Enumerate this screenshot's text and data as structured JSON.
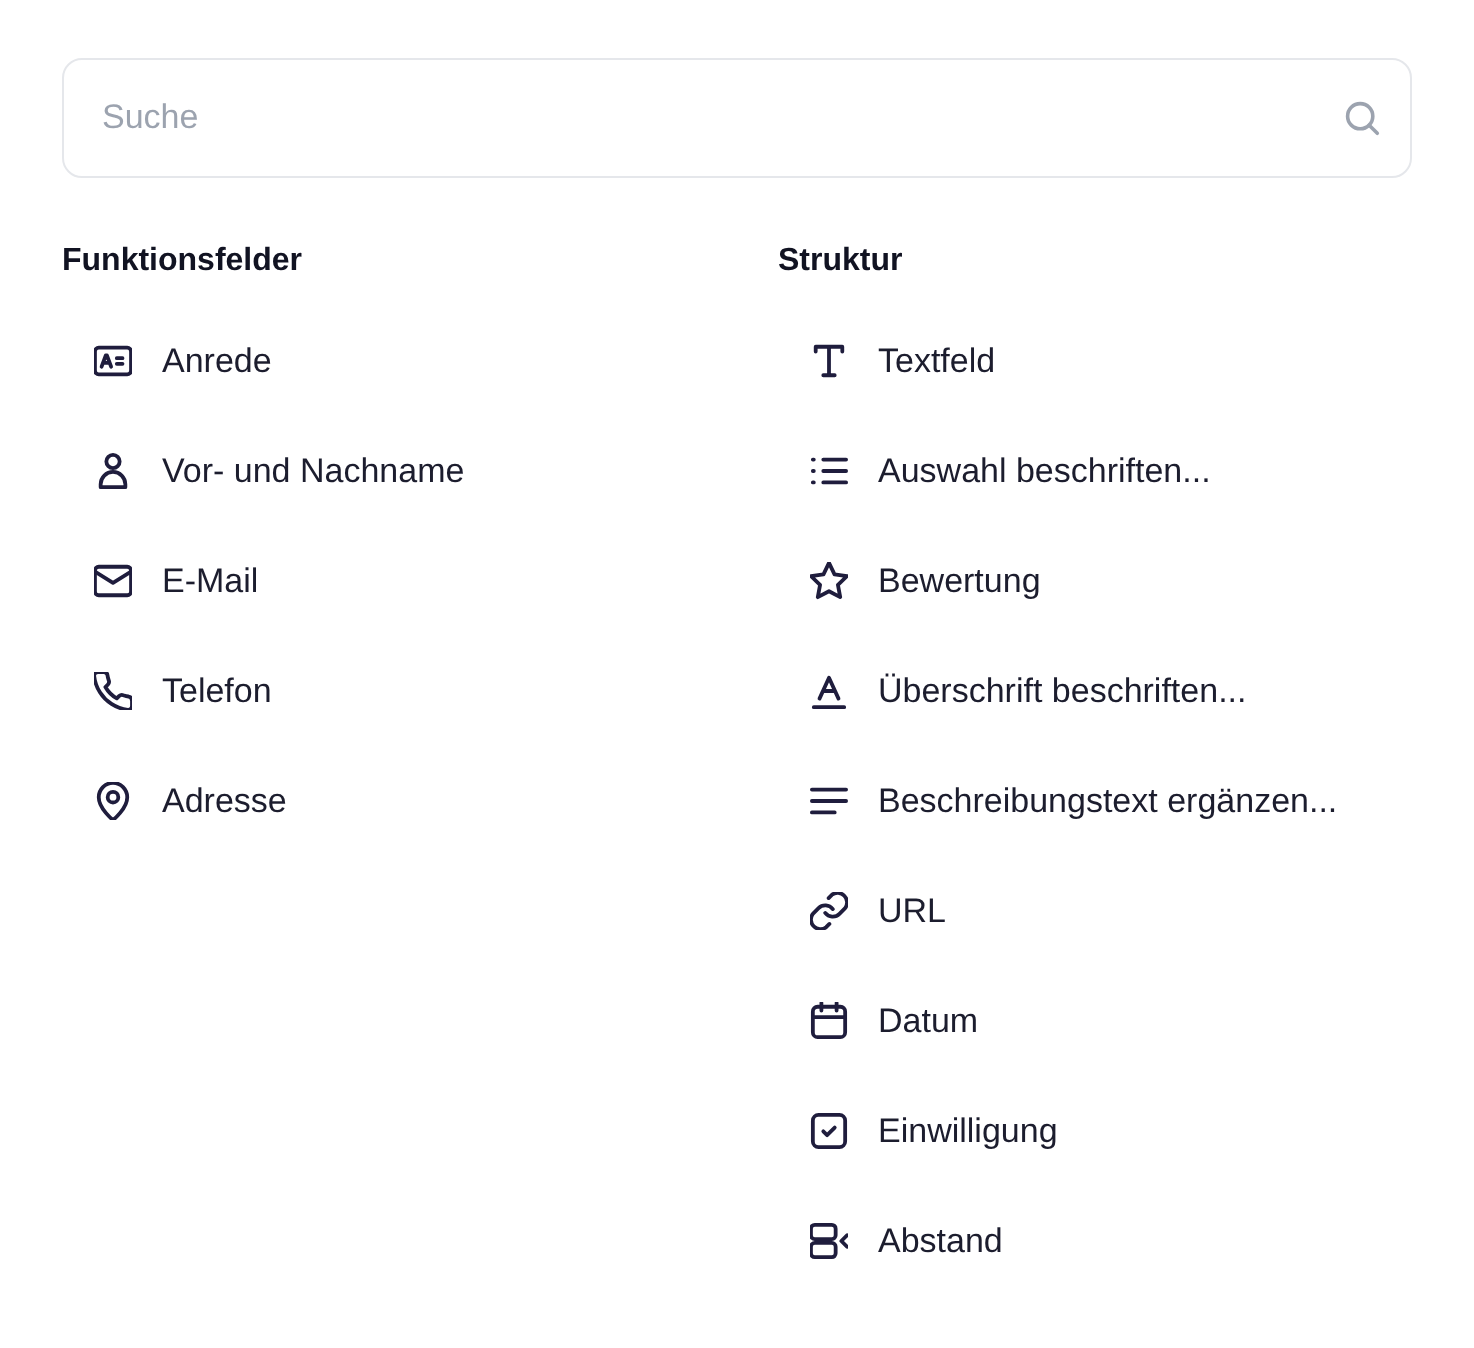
{
  "search": {
    "placeholder": "Suche"
  },
  "sections": [
    {
      "title": "Funktionsfelder",
      "items": [
        {
          "label": "Anrede"
        },
        {
          "label": "Vor- und Nachname"
        },
        {
          "label": "E-Mail"
        },
        {
          "label": "Telefon"
        },
        {
          "label": "Adresse"
        }
      ]
    },
    {
      "title": "Struktur",
      "items": [
        {
          "label": "Textfeld"
        },
        {
          "label": "Auswahl beschriften..."
        },
        {
          "label": "Bewertung"
        },
        {
          "label": "Überschrift beschriften..."
        },
        {
          "label": "Beschreibungstext ergänzen..."
        },
        {
          "label": "URL"
        },
        {
          "label": "Datum"
        },
        {
          "label": "Einwilligung"
        },
        {
          "label": "Abstand"
        }
      ]
    }
  ]
}
